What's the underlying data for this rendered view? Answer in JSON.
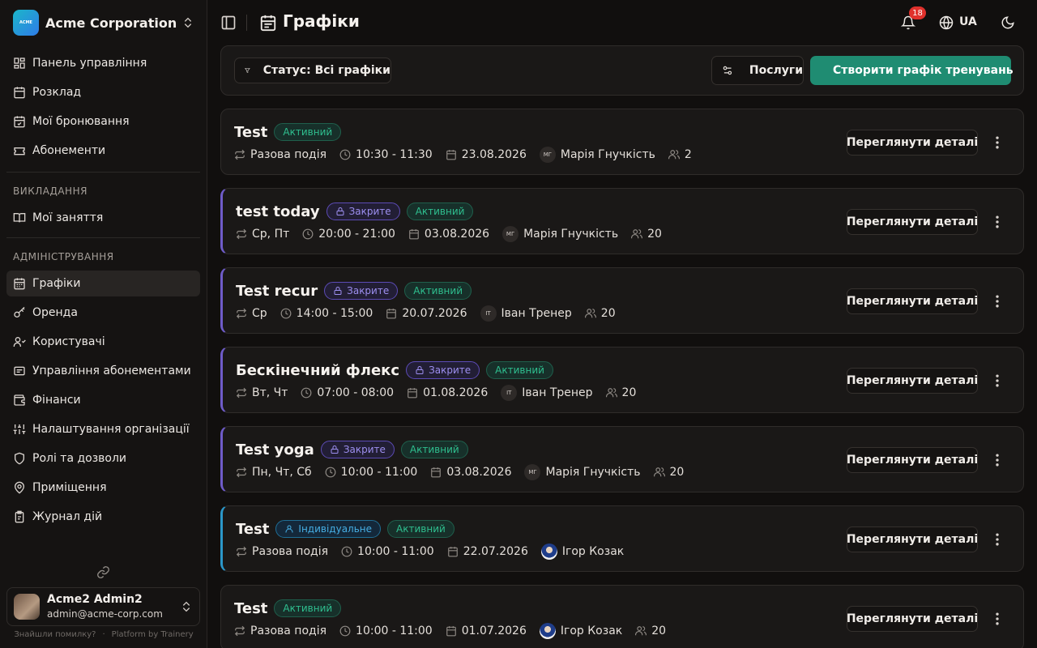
{
  "org": {
    "name": "Acme Corporation",
    "logo_text": "ACME"
  },
  "nav_main": [
    {
      "label": "Панель управління",
      "icon": "dashboard-icon"
    },
    {
      "label": "Розклад",
      "icon": "calendar-icon"
    },
    {
      "label": "Мої бронювання",
      "icon": "calendar-check-icon"
    },
    {
      "label": "Абонементи",
      "icon": "ticket-icon"
    }
  ],
  "section_teaching": "ВИКЛАДАННЯ",
  "nav_teaching": [
    {
      "label": "Мої заняття",
      "icon": "book-icon"
    }
  ],
  "section_admin": "АДМІНІСТРУВАННЯ",
  "nav_admin": [
    {
      "label": "Графіки",
      "icon": "calendar-grid-icon",
      "active": true
    },
    {
      "label": "Оренда",
      "icon": "key-icon"
    },
    {
      "label": "Користувачі",
      "icon": "users-icon"
    },
    {
      "label": "Управління абонементами",
      "icon": "list-icon"
    },
    {
      "label": "Фінанси",
      "icon": "wallet-icon"
    },
    {
      "label": "Налаштування організації",
      "icon": "settings-icon"
    },
    {
      "label": "Ролі та дозволи",
      "icon": "shield-icon"
    },
    {
      "label": "Приміщення",
      "icon": "map-pin-icon"
    },
    {
      "label": "Журнал дій",
      "icon": "clipboard-icon"
    }
  ],
  "user": {
    "name": "Acme2 Admin2",
    "email": "admin@acme-corp.com"
  },
  "footer": {
    "report": "Знайшли помилку?",
    "sep": "·",
    "platform": "Platform by Trainery"
  },
  "header": {
    "title": "Графіки",
    "notifications_count": "18",
    "language": "UA"
  },
  "filters": {
    "status_label": "Статус: Всі графіки",
    "services_label": "Послуги",
    "create_label": "Створити графік тренувань"
  },
  "cards": [
    {
      "title": "Test",
      "closed": false,
      "individual": false,
      "status": "Активний",
      "days": "Разова подія",
      "time": "10:30 - 11:30",
      "date": "23.08.2026",
      "trainer_initials": "МГ",
      "trainer": "Марія Гнучкість",
      "capacity": "2",
      "accent": "none"
    },
    {
      "title": "test today",
      "closed": true,
      "individual": false,
      "status": "Активний",
      "days": "Ср, Пт",
      "time": "20:00 - 21:00",
      "date": "03.08.2026",
      "trainer_initials": "МГ",
      "trainer": "Марія Гнучкість",
      "capacity": "20",
      "accent": "purple"
    },
    {
      "title": "Test recur",
      "closed": true,
      "individual": false,
      "status": "Активний",
      "days": "Ср",
      "time": "14:00 - 15:00",
      "date": "20.07.2026",
      "trainer_initials": "ІТ",
      "trainer": "Іван Тренер",
      "capacity": "20",
      "accent": "purple"
    },
    {
      "title": "Бескінечний флекс",
      "closed": true,
      "individual": false,
      "status": "Активний",
      "days": "Вт, Чт",
      "time": "07:00 - 08:00",
      "date": "01.08.2026",
      "trainer_initials": "ІТ",
      "trainer": "Іван Тренер",
      "capacity": "20",
      "accent": "purple"
    },
    {
      "title": "Test yoga",
      "closed": true,
      "individual": false,
      "status": "Активний",
      "days": "Пн, Чт, Сб",
      "time": "10:00 - 11:00",
      "date": "03.08.2026",
      "trainer_initials": "МГ",
      "trainer": "Марія Гнучкість",
      "capacity": "20",
      "accent": "purple"
    },
    {
      "title": "Test",
      "closed": false,
      "individual": true,
      "status": "Активний",
      "days": "Разова подія",
      "time": "10:00 - 11:00",
      "date": "22.07.2026",
      "trainer_initials": "",
      "trainer": "Ігор Козак",
      "capacity": "",
      "accent": "cyan"
    },
    {
      "title": "Test",
      "closed": false,
      "individual": false,
      "status": "Активний",
      "days": "Разова подія",
      "time": "10:00 - 11:00",
      "date": "01.07.2026",
      "trainer_initials": "",
      "trainer": "Ігор Козак",
      "capacity": "20",
      "accent": "none"
    }
  ],
  "labels": {
    "closed": "Закрите",
    "individual": "Індивідуальне",
    "details": "Переглянути деталі"
  }
}
